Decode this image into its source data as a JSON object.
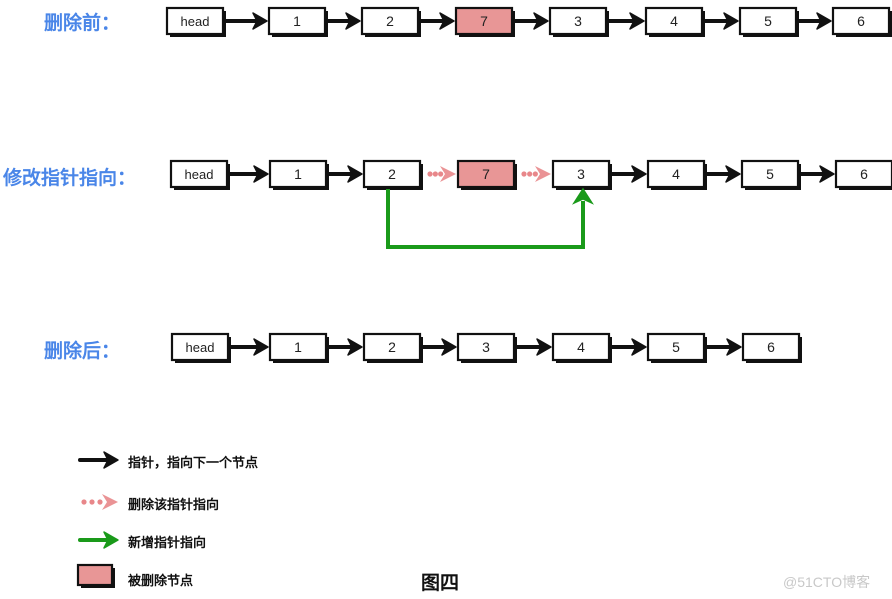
{
  "rows": [
    {
      "label": "删除前：",
      "nodes": [
        {
          "text": "head",
          "deleted": false
        },
        {
          "text": "1",
          "deleted": false
        },
        {
          "text": "2",
          "deleted": false
        },
        {
          "text": "7",
          "deleted": true
        },
        {
          "text": "3",
          "deleted": false
        },
        {
          "text": "4",
          "deleted": false
        },
        {
          "text": "5",
          "deleted": false
        },
        {
          "text": "6",
          "deleted": false
        }
      ],
      "links": [
        "pointer",
        "pointer",
        "pointer",
        "pointer",
        "pointer",
        "pointer",
        "pointer"
      ]
    },
    {
      "label": "修改指针指向：",
      "nodes": [
        {
          "text": "head",
          "deleted": false
        },
        {
          "text": "1",
          "deleted": false
        },
        {
          "text": "2",
          "deleted": false
        },
        {
          "text": "7",
          "deleted": true
        },
        {
          "text": "3",
          "deleted": false
        },
        {
          "text": "4",
          "deleted": false
        },
        {
          "text": "5",
          "deleted": false
        },
        {
          "text": "6",
          "deleted": false
        }
      ],
      "links": [
        "pointer",
        "pointer",
        "removed",
        "removed",
        "pointer",
        "pointer",
        "pointer"
      ],
      "new_link": {
        "from": "2",
        "to": "3"
      }
    },
    {
      "label": "删除后：",
      "nodes": [
        {
          "text": "head",
          "deleted": false
        },
        {
          "text": "1",
          "deleted": false
        },
        {
          "text": "2",
          "deleted": false
        },
        {
          "text": "3",
          "deleted": false
        },
        {
          "text": "4",
          "deleted": false
        },
        {
          "text": "5",
          "deleted": false
        },
        {
          "text": "6",
          "deleted": false
        }
      ],
      "links": [
        "pointer",
        "pointer",
        "pointer",
        "pointer",
        "pointer",
        "pointer"
      ]
    }
  ],
  "legend": [
    {
      "icon": "black-arrow-icon",
      "text": "指针，指向下一个节点"
    },
    {
      "icon": "dotted-pink-arrow-icon",
      "text": "删除该指针指向"
    },
    {
      "icon": "green-arrow-icon",
      "text": "新增指针指向"
    },
    {
      "icon": "deleted-node-swatch-icon",
      "text": "被删除节点"
    }
  ],
  "caption": "图四",
  "watermark": "@51CTO博客",
  "colors": {
    "label": "#4a86e8",
    "pointer": "#111111",
    "removed": "#e8878a",
    "new_pointer": "#1a9a1a",
    "deleted_fill": "#e89696"
  }
}
